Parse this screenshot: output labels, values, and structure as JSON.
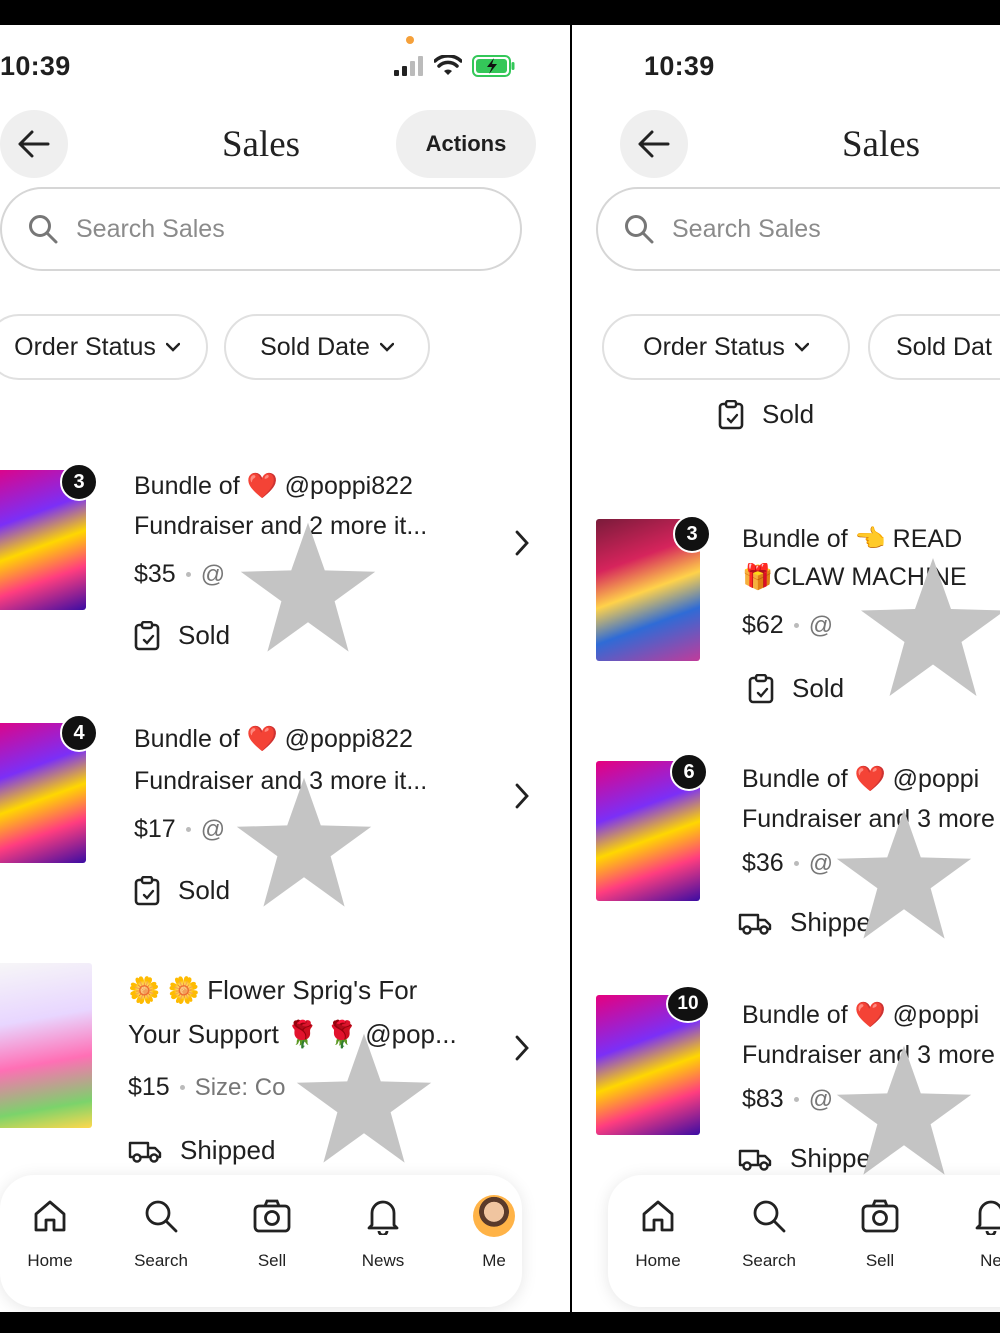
{
  "status": {
    "time": "10:39"
  },
  "left": {
    "title": "Sales",
    "actions_label": "Actions",
    "search_placeholder": "Search Sales",
    "filters": [
      "Order Status",
      "Sold Date"
    ],
    "items": [
      {
        "badge": "3",
        "line1": "Bundle of ❤️ @poppi822",
        "line2": "Fundraiser and 2 more it...",
        "price": "$35",
        "sub": "@",
        "status": "Sold",
        "status_icon": "clipboard-icon"
      },
      {
        "badge": "4",
        "line1": "Bundle of ❤️ @poppi822",
        "line2": "Fundraiser and 3 more it...",
        "price": "$17",
        "sub": "@",
        "status": "Sold",
        "status_icon": "clipboard-icon"
      },
      {
        "badge": "",
        "line1": "🌼 🌼 Flower Sprig's For",
        "line2": "Your Support 🌹 🌹 @pop...",
        "price": "$15",
        "sub": "Size: Co",
        "status": "Shipped",
        "status_icon": "truck-icon"
      }
    ]
  },
  "right": {
    "title": "Sales",
    "search_placeholder": "Search Sales",
    "filters": [
      "Order Status",
      "Sold Dat"
    ],
    "top_status": "Sold",
    "items": [
      {
        "badge": "3",
        "line1": "Bundle of 👈 READ",
        "line2": "🎁CLAW MACHINE",
        "price": "$62",
        "sub": "@",
        "status": "Sold",
        "status_icon": "clipboard-icon"
      },
      {
        "badge": "6",
        "line1": "Bundle of ❤️ @poppi",
        "line2": "Fundraiser and 3 more",
        "price": "$36",
        "sub": "@",
        "status": "Shippe",
        "status_icon": "truck-icon"
      },
      {
        "badge": "10",
        "line1": "Bundle of ❤️ @poppi",
        "line2": "Fundraiser and 3 more",
        "price": "$83",
        "sub": "@",
        "status": "Shippe",
        "status_icon": "truck-icon"
      }
    ]
  },
  "nav": {
    "left": [
      "Home",
      "Search",
      "Sell",
      "News",
      "Me"
    ],
    "right": [
      "Home",
      "Search",
      "Sell",
      "Ne"
    ]
  },
  "colors": {
    "accent_dot": "#f5a03a",
    "battery": "#34c759",
    "star_overlay": "#c4c4c4"
  }
}
